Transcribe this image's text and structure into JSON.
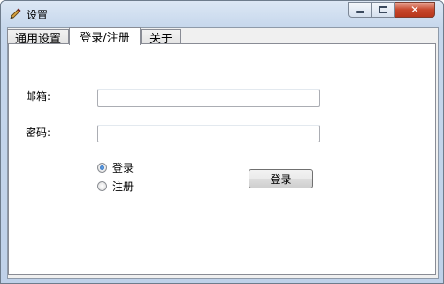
{
  "window": {
    "title": "设置",
    "icons": {
      "app": "pencil-icon",
      "minimize": "minimize-icon",
      "maximize": "maximize-icon",
      "close": "close-icon"
    }
  },
  "tabs": [
    {
      "label": "通用设置",
      "active": false
    },
    {
      "label": "登录/注册",
      "active": true
    },
    {
      "label": "关于",
      "active": false
    }
  ],
  "form": {
    "email_label": "邮箱:",
    "email_value": "",
    "password_label": "密码:",
    "password_value": "",
    "mode_options": [
      {
        "label": "登录",
        "selected": true
      },
      {
        "label": "注册",
        "selected": false
      }
    ],
    "submit_label": "登录"
  }
}
